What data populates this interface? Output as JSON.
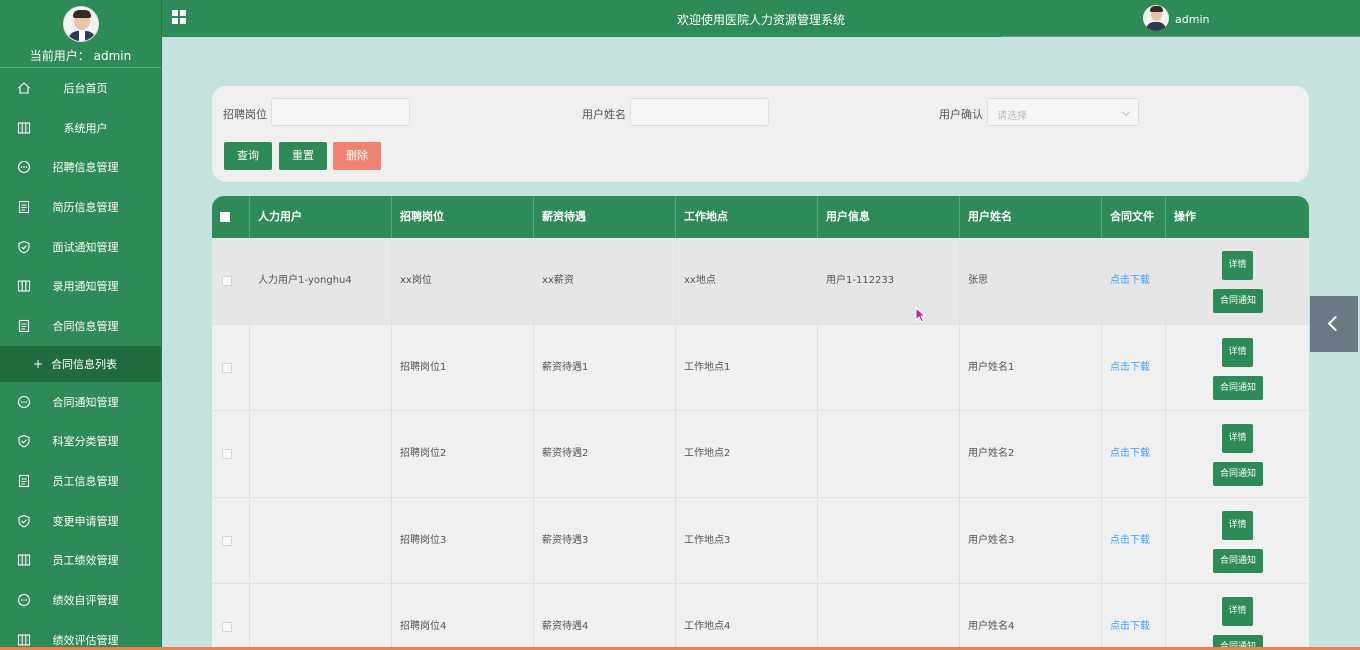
{
  "sidebar": {
    "current_user": "当前用户：  admin",
    "active_sub": "合同信息列表",
    "items": [
      {
        "label": "后台首页",
        "icon": "home-icon"
      },
      {
        "label": "系统用户",
        "icon": "columns-icon"
      },
      {
        "label": "招聘信息管理",
        "icon": "chat-icon"
      },
      {
        "label": "简历信息管理",
        "icon": "document-icon"
      },
      {
        "label": "面试通知管理",
        "icon": "shield-check-icon"
      },
      {
        "label": "录用通知管理",
        "icon": "columns-icon"
      },
      {
        "label": "合同信息管理",
        "icon": "document-icon"
      },
      {
        "label": "合同通知管理",
        "icon": "chat-icon"
      },
      {
        "label": "科室分类管理",
        "icon": "shield-check-icon"
      },
      {
        "label": "员工信息管理",
        "icon": "document-icon"
      },
      {
        "label": "变更申请管理",
        "icon": "shield-check-icon"
      },
      {
        "label": "员工绩效管理",
        "icon": "columns-icon"
      },
      {
        "label": "绩效自评管理",
        "icon": "chat-icon"
      },
      {
        "label": "绩效评估管理",
        "icon": "columns-icon"
      }
    ]
  },
  "header": {
    "title": "欢迎使用医院人力资源管理系统",
    "username": "admin"
  },
  "search": {
    "field1_label": "招聘岗位",
    "field2_label": "用户姓名",
    "field3_label": "用户确认",
    "select_placeholder": "请选择",
    "query_btn": "查询",
    "reset_btn": "重置",
    "delete_btn": "删除"
  },
  "table": {
    "columns": [
      "人力用户",
      "招聘岗位",
      "薪资待遇",
      "工作地点",
      "用户信息",
      "用户姓名",
      "合同文件",
      "操作"
    ],
    "rows": [
      {
        "hr_user": "人力用户1-yonghu4",
        "position": "xx岗位",
        "salary": "xx薪资",
        "location": "xx地点",
        "user_info": "用户1-112233",
        "user_name": "张思",
        "file": "点击下载"
      },
      {
        "hr_user": "",
        "position": "招聘岗位1",
        "salary": "薪资待遇1",
        "location": "工作地点1",
        "user_info": "",
        "user_name": "用户姓名1",
        "file": "点击下载"
      },
      {
        "hr_user": "",
        "position": "招聘岗位2",
        "salary": "薪资待遇2",
        "location": "工作地点2",
        "user_info": "",
        "user_name": "用户姓名2",
        "file": "点击下载"
      },
      {
        "hr_user": "",
        "position": "招聘岗位3",
        "salary": "薪资待遇3",
        "location": "工作地点3",
        "user_info": "",
        "user_name": "用户姓名3",
        "file": "点击下载"
      },
      {
        "hr_user": "",
        "position": "招聘岗位4",
        "salary": "薪资待遇4",
        "location": "工作地点4",
        "user_info": "",
        "user_name": "用户姓名4",
        "file": "点击下载"
      }
    ],
    "detail_btn": "详情",
    "notify_btn": "合同通知"
  },
  "colors": {
    "primary": "#2e8b57",
    "background": "#c6e2df",
    "danger": "#f08272",
    "link": "#409eff"
  }
}
